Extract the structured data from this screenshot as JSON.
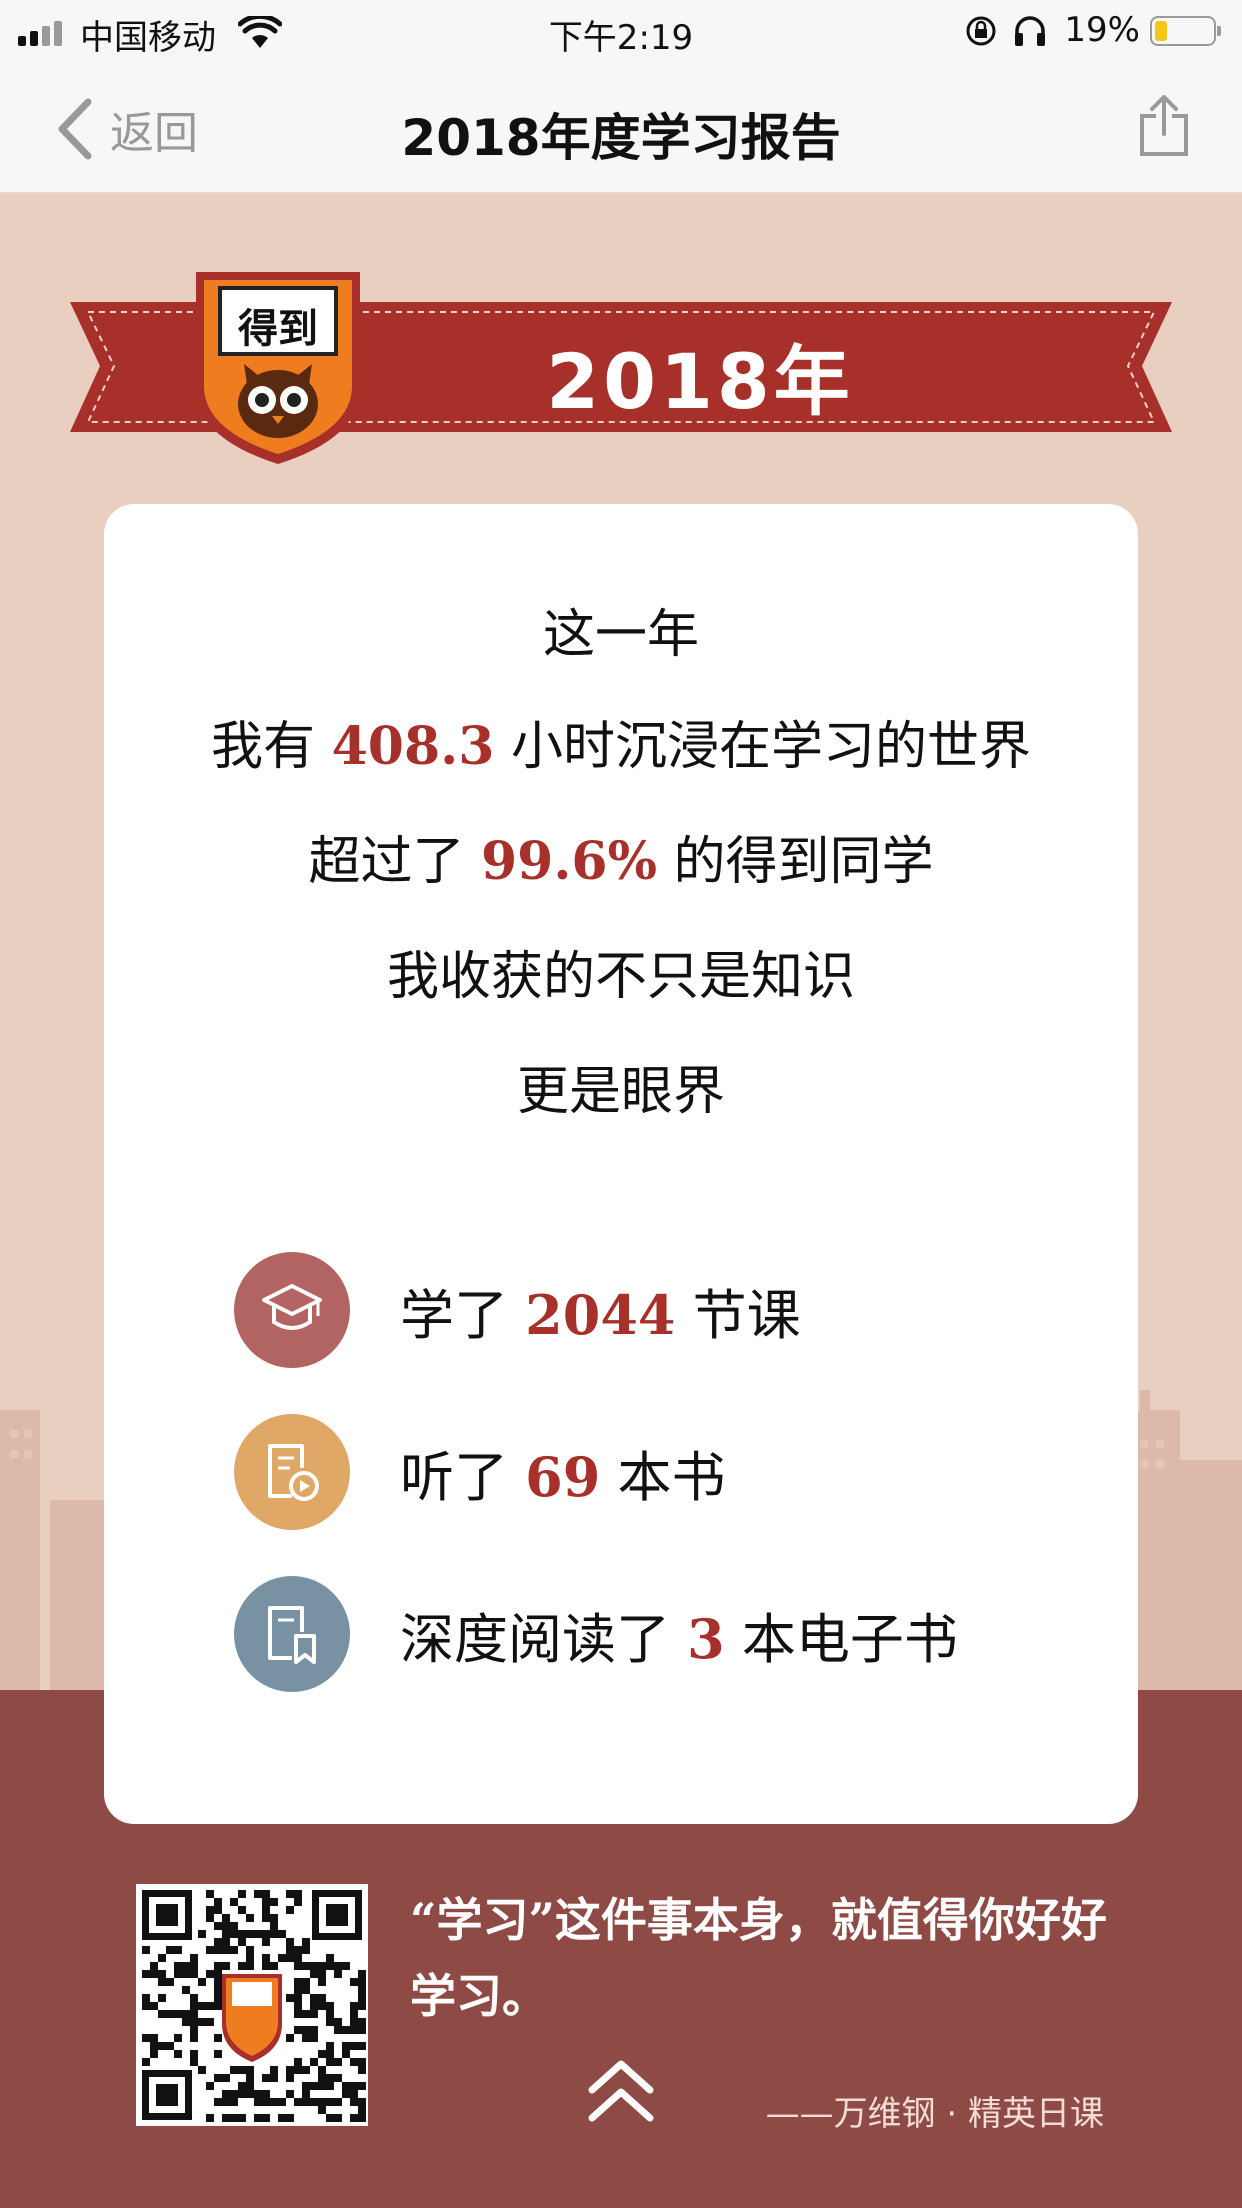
{
  "status_bar": {
    "carrier": "中国移动",
    "time": "下午2:19",
    "battery_percent": "19%",
    "battery_level": 0.19,
    "icons": [
      "signal-icon",
      "wifi-icon",
      "orientation-lock-icon",
      "headphones-icon",
      "battery-icon"
    ]
  },
  "nav": {
    "back_label": "返回",
    "title": "2018年度学习报告",
    "share_icon": "share-icon"
  },
  "banner": {
    "logo_text": "得到",
    "year": "2018年"
  },
  "card": {
    "intro_lines": [
      "这一年",
      {
        "prefix": "我有 ",
        "value": "408.3",
        "suffix": " 小时沉浸在学习的世界"
      },
      {
        "prefix": "超过了 ",
        "value": "99.6%",
        "suffix": " 的得到同学"
      },
      "我收获的不只是知识",
      "更是眼界"
    ],
    "stats": [
      {
        "icon": "graduation-cap-icon",
        "color": "#b26462",
        "prefix": "学了 ",
        "value": "2044",
        "suffix": " 节课"
      },
      {
        "icon": "audiobook-icon",
        "color": "#e0a867",
        "prefix": "听了 ",
        "value": "69",
        "suffix": " 本书"
      },
      {
        "icon": "ebook-icon",
        "color": "#7892a4",
        "prefix": "深度阅读了 ",
        "value": "3",
        "suffix": " 本电子书"
      }
    ]
  },
  "footer": {
    "qr_logo_text": "得到",
    "quote": "“学习”这件事本身，就值得你好好学习。",
    "author": "——万维钢 · 精英日课",
    "up_icon": "chevron-up-icon"
  },
  "colors": {
    "accent_red": "#a8302a",
    "banner_red": "#a8302a",
    "page_bg": "#e9cfc0",
    "footer_bg": "#8e4a44"
  }
}
